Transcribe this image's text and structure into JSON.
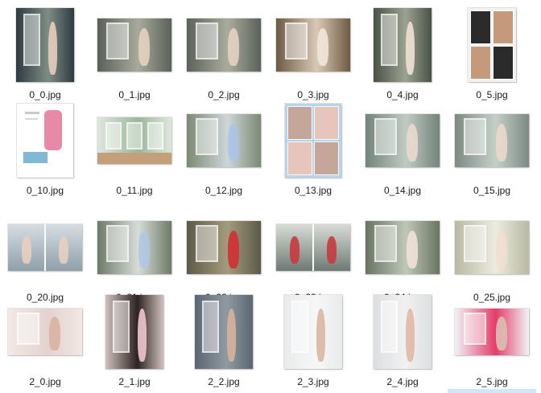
{
  "window": {
    "view": "Large icons"
  },
  "items": [
    {
      "name": "0_0.jpg",
      "shape": "portrait",
      "colors": [
        "#2e3a40",
        "#7f8c86",
        "#e7cdbd"
      ]
    },
    {
      "name": "0_1.jpg",
      "shape": "landscape",
      "colors": [
        "#59615a",
        "#a7aa9a",
        "#e4d2c2"
      ]
    },
    {
      "name": "0_2.jpg",
      "shape": "landscape",
      "colors": [
        "#5a625b",
        "#a9ac9c",
        "#e4d2c2"
      ]
    },
    {
      "name": "0_3.jpg",
      "shape": "landscape",
      "colors": [
        "#6f5a45",
        "#d8c9b4",
        "#f1e6d9"
      ]
    },
    {
      "name": "0_4.jpg",
      "shape": "portrait",
      "colors": [
        "#4a5146",
        "#9aa392",
        "#f0e2d3"
      ]
    },
    {
      "name": "0_5.jpg",
      "shape": "collage-a",
      "colors": [
        "#2b2a2b",
        "#c49a7a",
        "#f2f2f2"
      ]
    },
    {
      "name": "0_10.jpg",
      "shape": "product",
      "colors": [
        "#ffffff",
        "#e88aa7",
        "#7fb9d6"
      ]
    },
    {
      "name": "0_11.jpg",
      "shape": "room",
      "colors": [
        "#dfe7dd",
        "#9bb79a",
        "#c4a07a"
      ]
    },
    {
      "name": "0_12.jpg",
      "shape": "landscape",
      "colors": [
        "#7a8a74",
        "#cfd6d9",
        "#a9c4e4"
      ]
    },
    {
      "name": "0_13.jpg",
      "shape": "collage-b",
      "colors": [
        "#c4a69b",
        "#e6c5bd",
        "#b7d4ea"
      ]
    },
    {
      "name": "0_14.jpg",
      "shape": "landscape",
      "colors": [
        "#73847a",
        "#bfcac3",
        "#e9d9cf"
      ]
    },
    {
      "name": "0_15.jpg",
      "shape": "landscape",
      "colors": [
        "#7c8a82",
        "#c4cfc8",
        "#ead8cc"
      ]
    },
    {
      "name": "0_20.jpg",
      "shape": "split",
      "colors": [
        "#8fa0a9",
        "#d6dde2",
        "#e8cfc0"
      ]
    },
    {
      "name": "0_21.jpg",
      "shape": "landscape",
      "colors": [
        "#6e7a68",
        "#d6ddd8",
        "#b2c6e3"
      ]
    },
    {
      "name": "0_22.jpg",
      "shape": "landscape",
      "colors": [
        "#5d5a4a",
        "#a49b7c",
        "#cf3030"
      ]
    },
    {
      "name": "0_23.jpg",
      "shape": "split",
      "colors": [
        "#6f7a74",
        "#d8dcd6",
        "#c63a3e"
      ]
    },
    {
      "name": "0_24.jpg",
      "shape": "landscape",
      "colors": [
        "#6a7463",
        "#bfc7b7",
        "#efe2d6"
      ]
    },
    {
      "name": "0_25.jpg",
      "shape": "landscape",
      "colors": [
        "#b9b9a4",
        "#ecebdf",
        "#f1dfd1"
      ]
    },
    {
      "name": "2_0.jpg",
      "shape": "wide",
      "colors": [
        "#f2e8e6",
        "#e3d2cf",
        "#d9b3a3"
      ]
    },
    {
      "name": "2_1.jpg",
      "shape": "portrait",
      "colors": [
        "#cfc1bd",
        "#2d2321",
        "#f0c7cf"
      ]
    },
    {
      "name": "2_2.jpg",
      "shape": "portrait",
      "colors": [
        "#5a6670",
        "#8f9aa2",
        "#d6b39c"
      ]
    },
    {
      "name": "2_3.jpg",
      "shape": "portrait",
      "colors": [
        "#e8eaec",
        "#f7f7f7",
        "#d9b7a4"
      ]
    },
    {
      "name": "2_4.jpg",
      "shape": "portrait",
      "colors": [
        "#dcdfe1",
        "#f1f1f1",
        "#dfb9a3"
      ]
    },
    {
      "name": "2_5.jpg",
      "shape": "wide",
      "colors": [
        "#eff3f5",
        "#e53b6a",
        "#d9c0b0"
      ]
    }
  ]
}
